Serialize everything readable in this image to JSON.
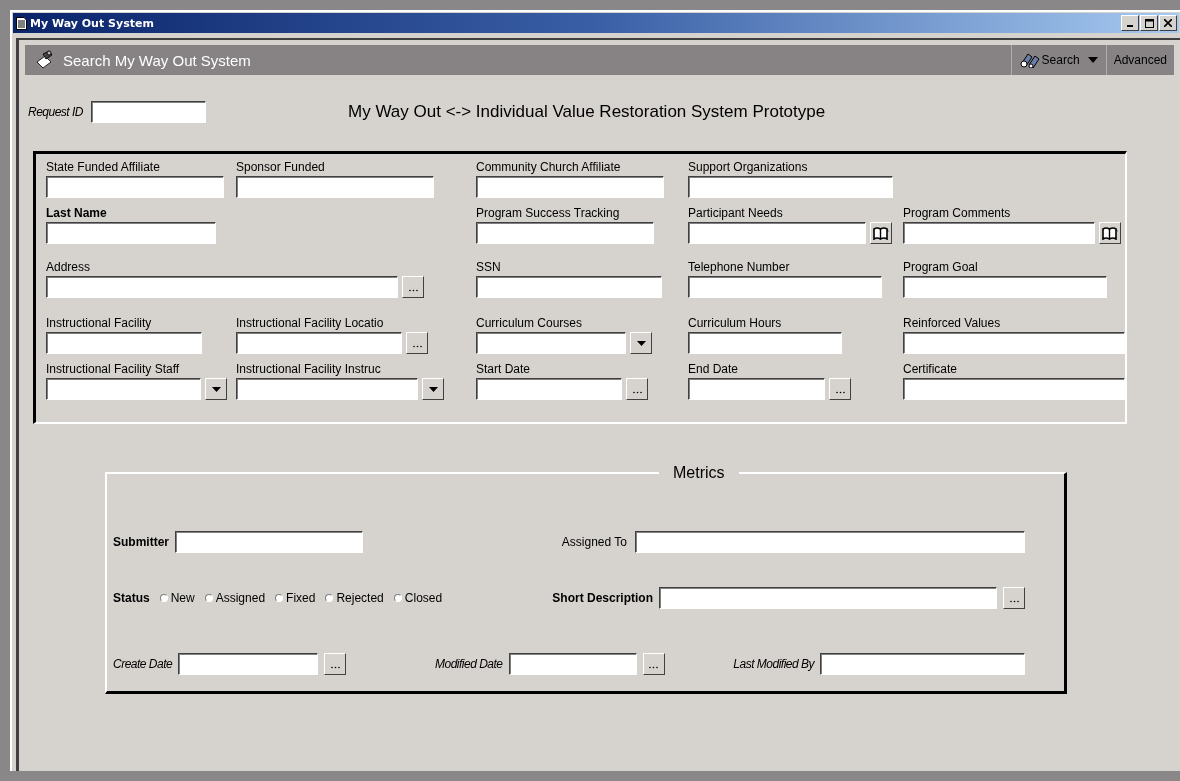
{
  "window": {
    "title": "My Way Out System"
  },
  "header": {
    "title": "Search My Way Out System",
    "search_button": "Search",
    "advanced_button": "Advanced"
  },
  "request_id": {
    "label": "Request ID"
  },
  "form_title": "My Way Out <-> Individual Value Restoration System Prototype",
  "field_rows": [
    [
      {
        "label": "State Funded Affiliate",
        "kind": "text",
        "bold": false
      },
      {
        "label": "Sponsor Funded",
        "kind": "text",
        "bold": false
      },
      {
        "label": "Community Church Affiliate",
        "kind": "text",
        "bold": false
      },
      {
        "label": "Support Organizations",
        "kind": "text",
        "bold": false
      }
    ],
    [
      {
        "label": "Last Name",
        "kind": "text",
        "bold": true
      },
      {
        "label": "Program Success Tracking",
        "kind": "text",
        "bold": false
      },
      {
        "label": "Participant Needs",
        "kind": "book",
        "bold": false
      },
      {
        "label": "Program Comments",
        "kind": "book",
        "bold": false
      }
    ],
    [
      {
        "label": "Address",
        "kind": "ellipsis",
        "bold": false
      },
      {
        "label": "SSN",
        "kind": "text",
        "bold": false
      },
      {
        "label": "Telephone Number",
        "kind": "text",
        "bold": false
      },
      {
        "label": "Program Goal",
        "kind": "text",
        "bold": false
      }
    ],
    [
      {
        "label": "Instructional Facility",
        "kind": "text",
        "bold": false
      },
      {
        "label": "Instructional Facility Locatio",
        "kind": "ellipsis",
        "bold": false
      },
      {
        "label": "Curriculum Courses",
        "kind": "dropdown",
        "bold": false
      },
      {
        "label": "Curriculum Hours",
        "kind": "text",
        "bold": false
      },
      {
        "label": "Reinforced Values",
        "kind": "text",
        "bold": false
      }
    ],
    [
      {
        "label": "Instructional Facility Staff",
        "kind": "dropdown",
        "bold": false
      },
      {
        "label": "Instructional Facility Instruc",
        "kind": "dropdown",
        "bold": false
      },
      {
        "label": "Start Date",
        "kind": "ellipsis",
        "bold": false
      },
      {
        "label": "End Date",
        "kind": "ellipsis",
        "bold": false
      },
      {
        "label": "Certificate",
        "kind": "text",
        "bold": false
      }
    ]
  ],
  "metrics": {
    "title": "Metrics",
    "submitter": {
      "label": "Submitter"
    },
    "assigned_to": {
      "label": "Assigned To"
    },
    "status": {
      "label": "Status",
      "options": [
        {
          "label": "New",
          "selected": false
        },
        {
          "label": "Assigned",
          "selected": false
        },
        {
          "label": "Fixed",
          "selected": false
        },
        {
          "label": "Rejected",
          "selected": false
        },
        {
          "label": "Closed",
          "selected": false
        }
      ]
    },
    "short_description": {
      "label": "Short Description"
    },
    "create_date": {
      "label": "Create Date"
    },
    "modified_date": {
      "label": "Modified Date"
    },
    "last_modified_by": {
      "label": "Last Modified By"
    }
  }
}
